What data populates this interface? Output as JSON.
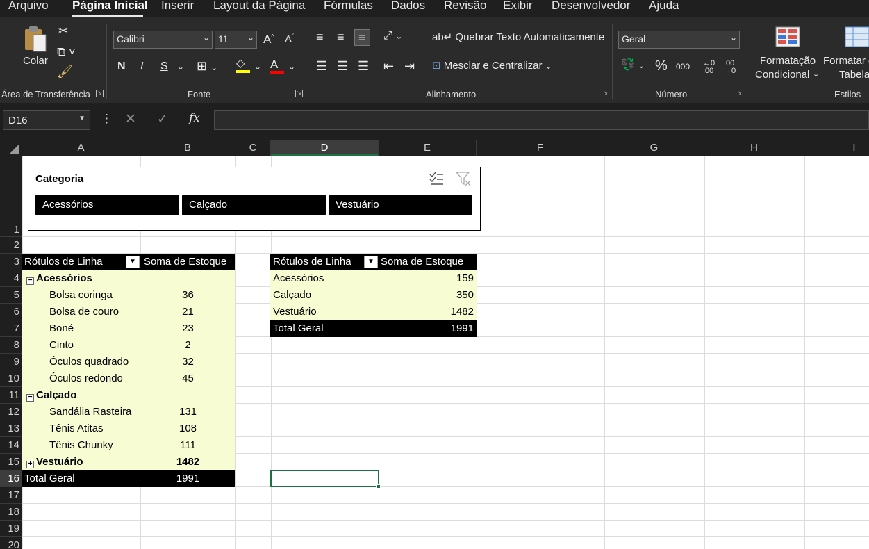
{
  "menu": [
    "Arquivo",
    "Página Inicial",
    "Inserir",
    "Layout da Página",
    "Fórmulas",
    "Dados",
    "Revisão",
    "Exibir",
    "Desenvolvedor",
    "Ajuda"
  ],
  "ribbon": {
    "clipboard": {
      "paste_label": "Colar",
      "group_label": "Área de Transferência"
    },
    "font": {
      "font_name": "Calibri",
      "font_size": "11",
      "bold": "N",
      "italic": "I",
      "underline": "S",
      "group_label": "Fonte"
    },
    "alignment": {
      "wrap_text": "Quebrar Texto Automaticamente",
      "merge_center": "Mesclar e Centralizar",
      "group_label": "Alinhamento"
    },
    "number": {
      "format": "Geral",
      "percent": "%",
      "thousands": "000",
      "group_label": "Número"
    },
    "styles": {
      "conditional_line1": "Formatação",
      "conditional_line2": "Condicional",
      "format_table_line1": "Formatar c",
      "format_table_line2": "Tabela",
      "group_label": "Estilos"
    }
  },
  "formula_bar": {
    "name_box": "D16",
    "fx": "fx",
    "formula": ""
  },
  "columns": [
    "A",
    "B",
    "C",
    "D",
    "E",
    "F",
    "G",
    "H",
    "I"
  ],
  "rows": [
    "1",
    "2",
    "3",
    "4",
    "5",
    "6",
    "7",
    "8",
    "9",
    "10",
    "11",
    "12",
    "13",
    "14",
    "15",
    "16",
    "17",
    "18",
    "19",
    "20"
  ],
  "slicer": {
    "title": "Categoria",
    "items": [
      "Acessórios",
      "Calçado",
      "Vestuário"
    ]
  },
  "pivot1": {
    "header_label": "Rótulos de Linha",
    "header_value": "Soma de Estoque",
    "groups": [
      {
        "name": "Acessórios",
        "items": [
          {
            "label": "Bolsa coringa",
            "value": "36"
          },
          {
            "label": "Bolsa de couro",
            "value": "21"
          },
          {
            "label": "Boné",
            "value": "23"
          },
          {
            "label": "Cinto",
            "value": "2"
          },
          {
            "label": "Óculos quadrado",
            "value": "32"
          },
          {
            "label": "Óculos redondo",
            "value": "45"
          }
        ]
      },
      {
        "name": "Calçado",
        "items": [
          {
            "label": "Sandália Rasteira",
            "value": "131"
          },
          {
            "label": "Tênis Atitas",
            "value": "108"
          },
          {
            "label": "Tênis Chunky",
            "value": "111"
          }
        ]
      },
      {
        "name": "Vestuário",
        "value": "1482"
      }
    ],
    "total_label": "Total Geral",
    "total_value": "1991"
  },
  "pivot2": {
    "header_label": "Rótulos de Linha",
    "header_value": "Soma de Estoque",
    "rows": [
      {
        "label": "Acessórios",
        "value": "159"
      },
      {
        "label": "Calçado",
        "value": "350"
      },
      {
        "label": "Vestuário",
        "value": "1482"
      }
    ],
    "total_label": "Total Geral",
    "total_value": "1991"
  },
  "colors": {
    "pivot_fill": "#f7fcd3",
    "pivot_header": "#000000",
    "selection": "#1e7145"
  }
}
